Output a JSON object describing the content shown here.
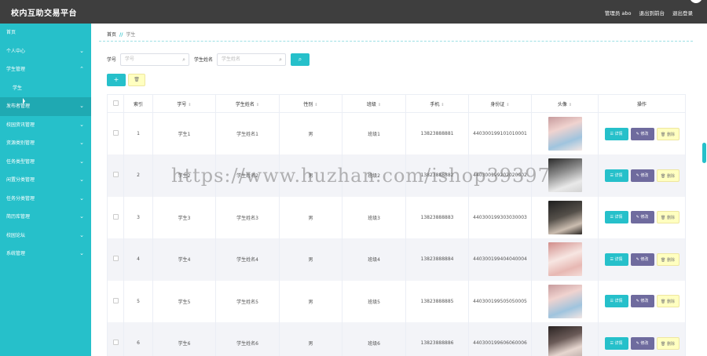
{
  "app": {
    "title": "校内互助交易平台"
  },
  "header": {
    "links": [
      "管理员 abo",
      "退出到前台",
      "退出登录"
    ]
  },
  "sidebar": {
    "items": [
      {
        "label": "首页",
        "chevron": false,
        "sub": false,
        "active": false
      },
      {
        "label": "个人中心",
        "chevron": "down",
        "sub": false,
        "active": false
      },
      {
        "label": "学生管理",
        "chevron": "up",
        "sub": false,
        "active": false
      },
      {
        "label": "学生",
        "chevron": false,
        "sub": true,
        "active": false
      },
      {
        "label": "发布者管理",
        "chevron": "down",
        "sub": false,
        "active": true
      },
      {
        "label": "校园资讯管理",
        "chevron": "down",
        "sub": false,
        "active": false
      },
      {
        "label": "资源类别管理",
        "chevron": "down",
        "sub": false,
        "active": false
      },
      {
        "label": "任务类型管理",
        "chevron": "down",
        "sub": false,
        "active": false
      },
      {
        "label": "闲置分类管理",
        "chevron": "down",
        "sub": false,
        "active": false
      },
      {
        "label": "任务分类管理",
        "chevron": "down",
        "sub": false,
        "active": false
      },
      {
        "label": "简历库管理",
        "chevron": "down",
        "sub": false,
        "active": false
      },
      {
        "label": "校园论坛",
        "chevron": "down",
        "sub": false,
        "active": false
      },
      {
        "label": "系统管理",
        "chevron": "down",
        "sub": false,
        "active": false
      }
    ]
  },
  "breadcrumb": {
    "home": "首页",
    "separator": "//",
    "current": "学生"
  },
  "search": {
    "student_no_label": "学号",
    "student_no_placeholder": "学号",
    "student_name_label": "学生姓名",
    "student_name_placeholder": "学生姓名",
    "search_icon": "search-icon"
  },
  "toolbar": {
    "add_icon": "plus-icon",
    "delete_icon": "trash-icon"
  },
  "table": {
    "columns": [
      "索引",
      "学号",
      "学生姓名",
      "性别",
      "班级",
      "手机",
      "身份证",
      "头像",
      "操作"
    ],
    "rows": [
      {
        "index": "1",
        "no": "学生1",
        "name": "学生姓名1",
        "gender": "男",
        "cls": "班级1",
        "phone": "13823888881",
        "id_card": "440300199101010001"
      },
      {
        "index": "2",
        "no": "学生2",
        "name": "学生姓名2",
        "gender": "男",
        "cls": "班级2",
        "phone": "13823888882",
        "id_card": "440300199202020002"
      },
      {
        "index": "3",
        "no": "学生3",
        "name": "学生姓名3",
        "gender": "男",
        "cls": "班级3",
        "phone": "13823888883",
        "id_card": "440300199303030003"
      },
      {
        "index": "4",
        "no": "学生4",
        "name": "学生姓名4",
        "gender": "男",
        "cls": "班级4",
        "phone": "13823888884",
        "id_card": "440300199404040004"
      },
      {
        "index": "5",
        "no": "学生5",
        "name": "学生姓名5",
        "gender": "男",
        "cls": "班级5",
        "phone": "13823888885",
        "id_card": "440300199505050005"
      },
      {
        "index": "6",
        "no": "学生6",
        "name": "学生姓名6",
        "gender": "男",
        "cls": "班级6",
        "phone": "13823888886",
        "id_card": "440300199606060006"
      }
    ],
    "actions": {
      "detail": "详情",
      "edit": "修改",
      "remove": "删除"
    }
  },
  "watermark": "https://www.huzhan.com/ishop39397",
  "colors": {
    "accent": "#26c0ca",
    "header": "#3e3e3e",
    "edit": "#6f6b9e",
    "delete": "#ffffc0"
  }
}
